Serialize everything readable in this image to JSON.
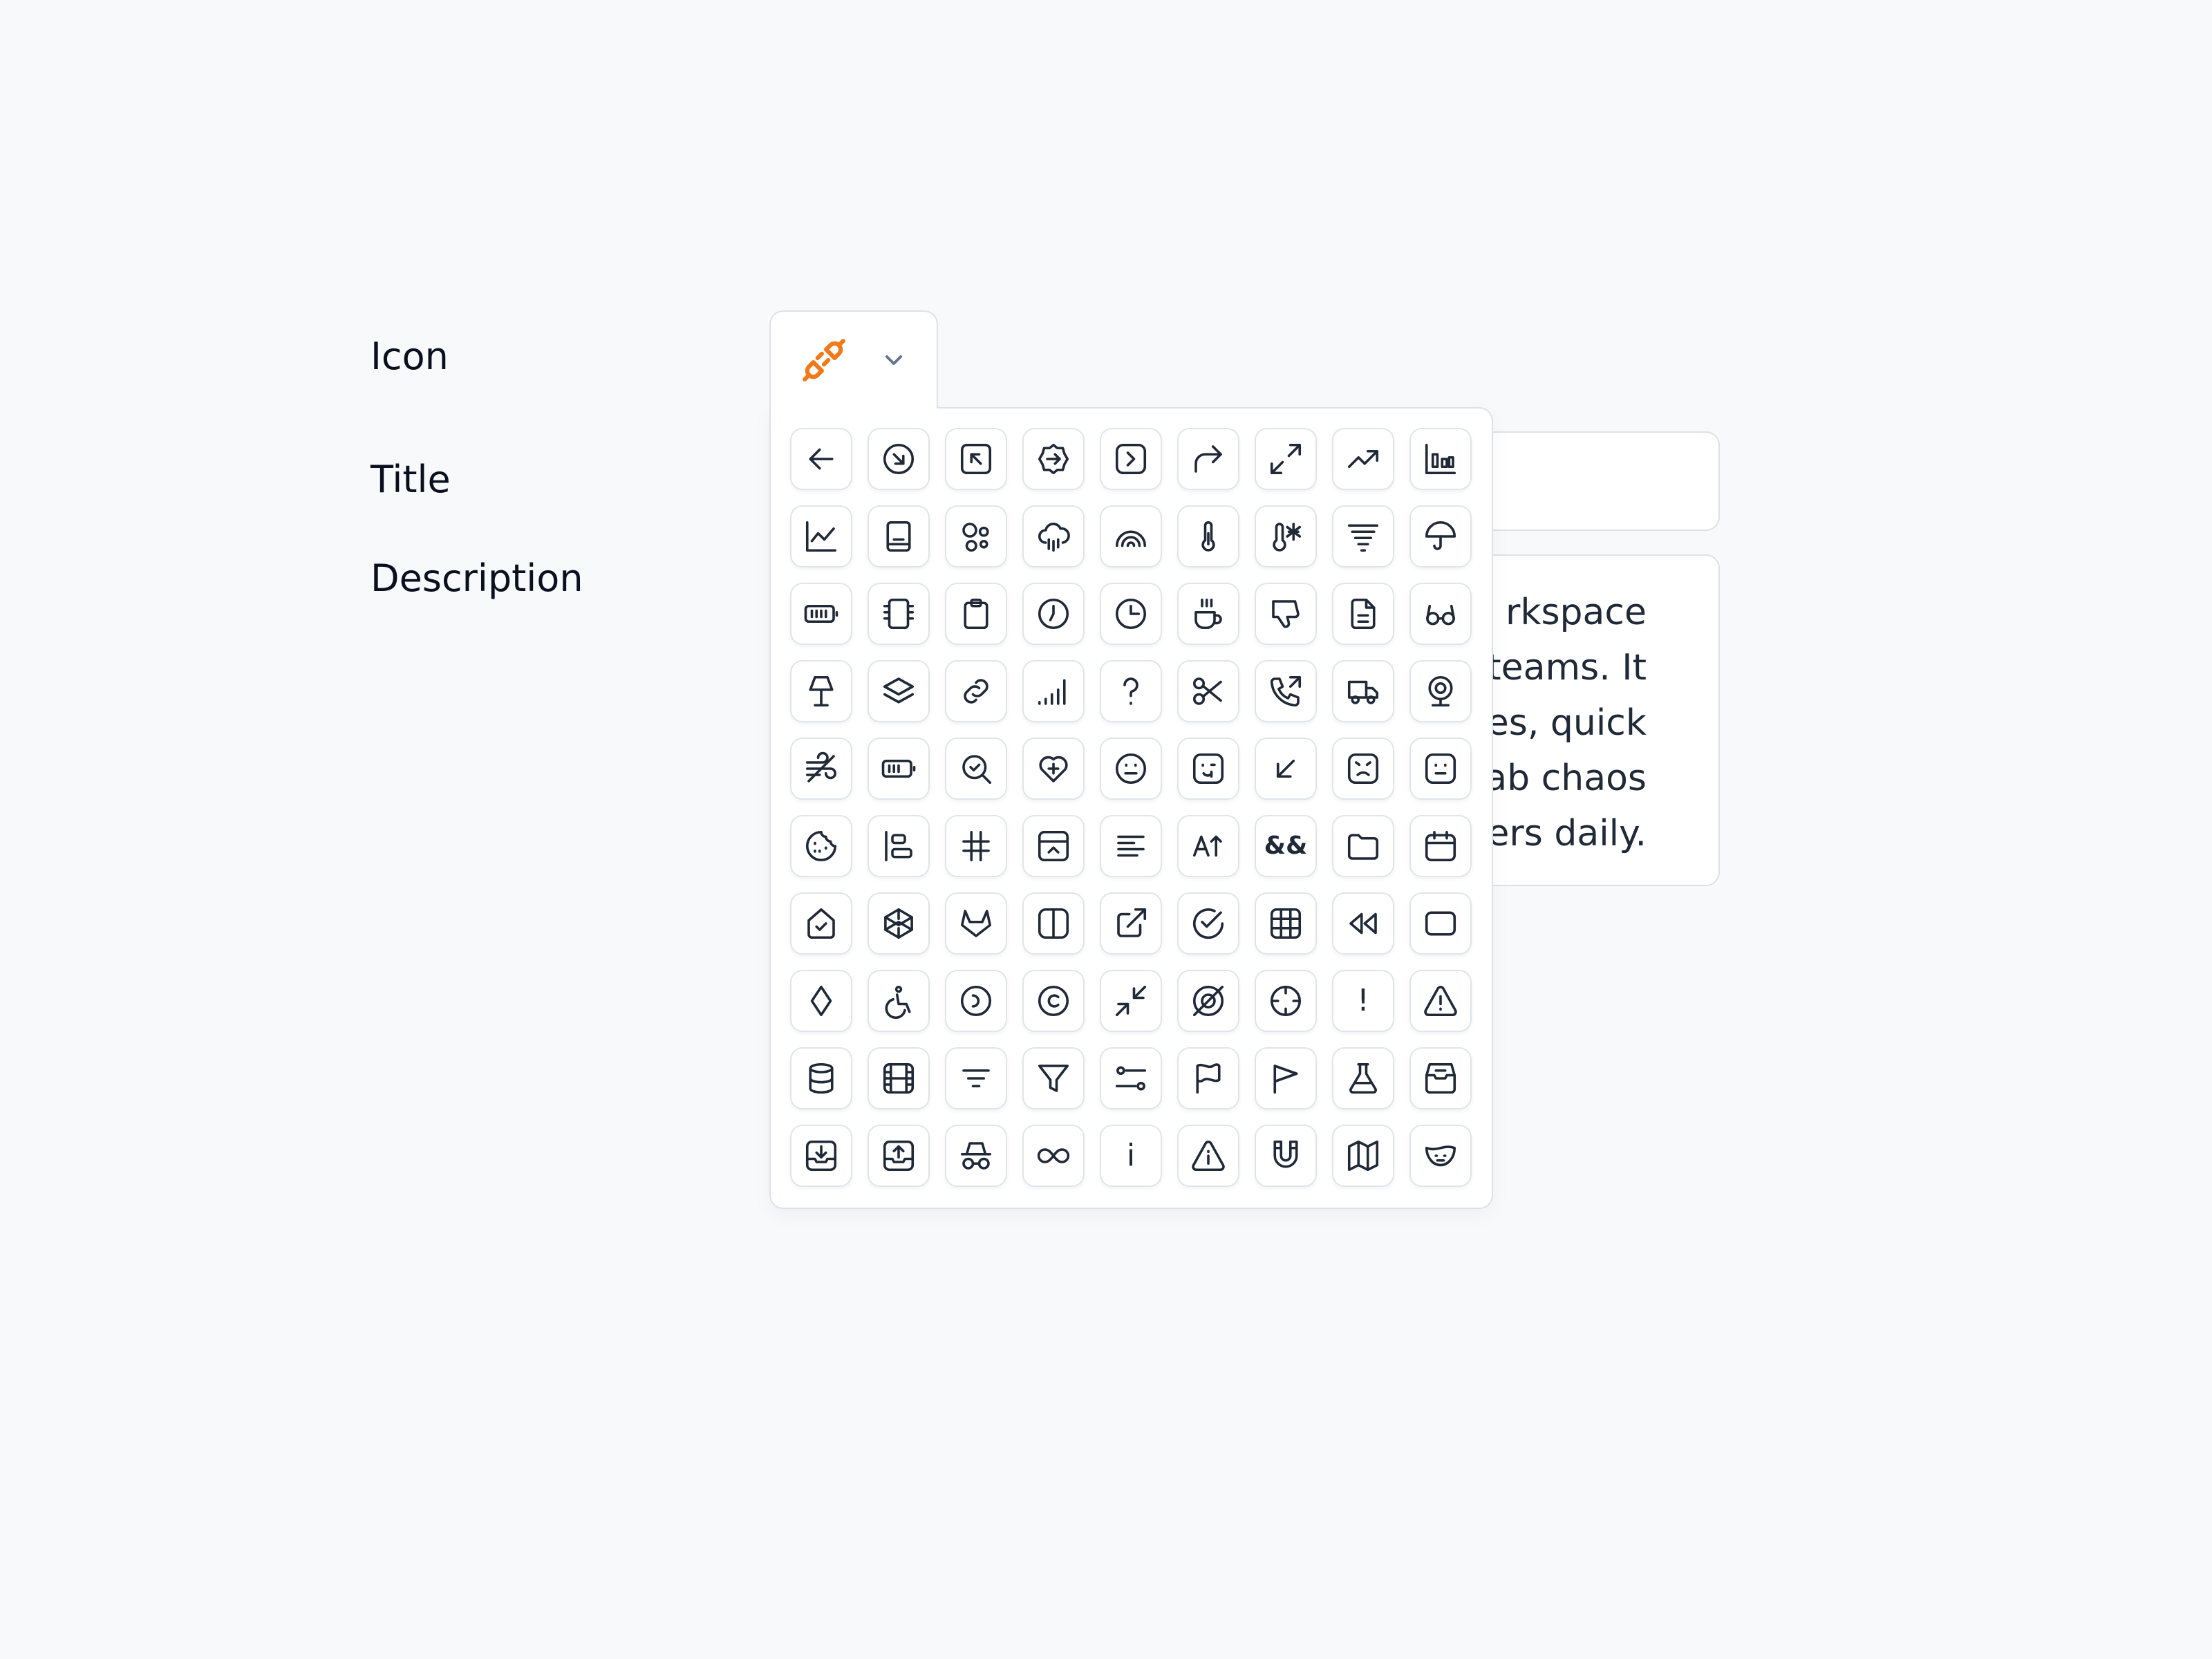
{
  "form": {
    "icon_label": "Icon",
    "title_label": "Title",
    "description_label": "Description",
    "title_value": "",
    "description_visible_lines": [
      "rkspace",
      "teams. It",
      "es, quick",
      "ab chaos",
      "ers daily."
    ]
  },
  "icon_picker": {
    "selected_icon": "plug-disconnected-icon",
    "selected_color": "#f07a1a",
    "chevron_color": "#64748b",
    "icon_stroke_color": "#1f2937",
    "icons": [
      "arrow-left-icon",
      "arrow-down-right-circle-icon",
      "arrow-up-left-square-icon",
      "arrow-right-badge-icon",
      "chevron-right-square-icon",
      "redo-icon",
      "expand-icon",
      "trending-up-icon",
      "bar-chart-square-icon",
      "line-chart-icon",
      "book-icon",
      "shapes-icon",
      "cloud-rain-icon",
      "rainbow-icon",
      "thermometer-icon",
      "thermometer-snowflake-icon",
      "tornado-icon",
      "umbrella-icon",
      "battery-full-icon",
      "cpu-chip-icon",
      "clipboard-icon",
      "clock-icon",
      "clock-three-icon",
      "coffee-icon",
      "thumbs-down-icon",
      "file-text-icon",
      "glasses-icon",
      "lamp-icon",
      "layers-icon",
      "link-icon",
      "signal-icon",
      "question-mark-icon",
      "scissors-icon",
      "phone-outgoing-icon",
      "truck-icon",
      "webcam-icon",
      "wind-icon",
      "battery-medium-icon",
      "zoom-check-icon",
      "heart-plus-icon",
      "smile-face-icon",
      "face-wink-square-icon",
      "arrow-down-left-icon",
      "face-angry-square-icon",
      "face-neutral-square-icon",
      "cookie-icon",
      "align-start-icon",
      "hash-icon",
      "panel-bottom-open-icon",
      "align-left-text-icon",
      "text-size-icon",
      "ampersands-icon",
      "folder-icon",
      "calendar-icon",
      "home-check-icon",
      "codepen-icon",
      "gitlab-icon",
      "columns-icon",
      "external-link-icon",
      "check-circle-icon",
      "grid-icon",
      "rewind-icon",
      "square-rounded-icon",
      "diamond-icon",
      "accessibility-icon",
      "circle-dashed-icon",
      "copyright-icon",
      "minimize-icon",
      "target-off-icon",
      "crosshair-icon",
      "exclamation-icon",
      "alert-triangle-icon",
      "database-icon",
      "film-icon",
      "filter-lines-icon",
      "funnel-icon",
      "sliders-icon",
      "flag-wave-icon",
      "flag-icon",
      "flask-icon",
      "archive-icon",
      "inbox-download-icon",
      "inbox-upload-icon",
      "incognito-icon",
      "infinity-icon",
      "info-letter-icon",
      "info-triangle-icon",
      "magnet-icon",
      "map-icon",
      "mask-icon"
    ]
  }
}
